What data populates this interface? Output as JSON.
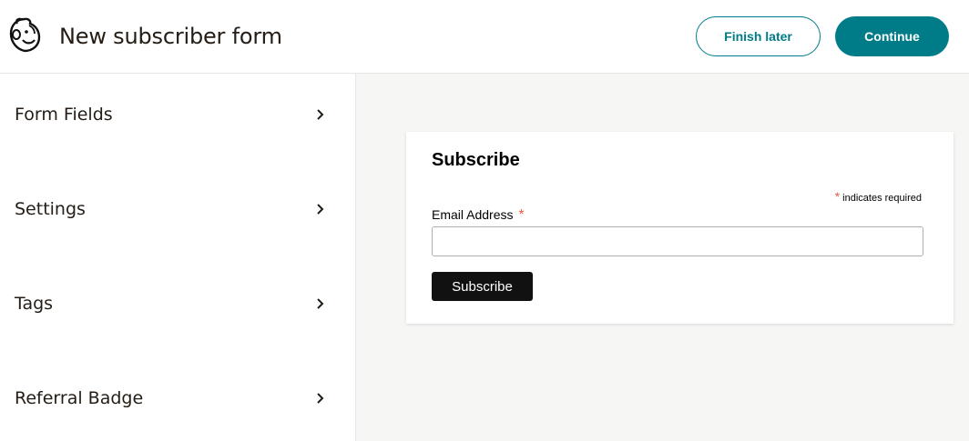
{
  "header": {
    "logo_icon": "mailchimp-freddie-icon",
    "title": "New subscriber form",
    "finish_later_label": "Finish later",
    "continue_label": "Continue"
  },
  "sidebar": {
    "items": [
      {
        "label": "Form Fields",
        "icon": "chevron-right-icon"
      },
      {
        "label": "Settings",
        "icon": "chevron-right-icon"
      },
      {
        "label": "Tags",
        "icon": "chevron-right-icon"
      },
      {
        "label": "Referral Badge",
        "icon": "chevron-right-icon"
      }
    ]
  },
  "form_preview": {
    "title": "Subscribe",
    "required_asterisk": "*",
    "required_note": "indicates required",
    "email_label": "Email Address",
    "email_value": "",
    "submit_label": "Subscribe"
  },
  "colors": {
    "accent": "#007c89",
    "required": "#e85c41",
    "preview_background": "#f6f6f4",
    "submit_button": "#111111"
  }
}
